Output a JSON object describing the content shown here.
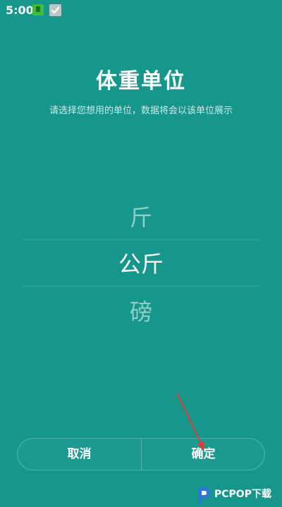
{
  "status_bar": {
    "time": "5:00",
    "icons": [
      "app-icon",
      "check-icon"
    ]
  },
  "header": {
    "title": "体重单位",
    "subtitle": "请选择您想用的单位，数据将会以该单位展示"
  },
  "picker": {
    "options": [
      "斤",
      "公斤",
      "磅"
    ],
    "selected_index": 1
  },
  "buttons": {
    "cancel_label": "取消",
    "confirm_label": "确定"
  },
  "watermark": {
    "text": "PCPOP下载"
  },
  "colors": {
    "background": "#17968c",
    "text": "#ffffff",
    "dim_text": "#8fcfc8",
    "annotation_arrow": "#e53935"
  }
}
